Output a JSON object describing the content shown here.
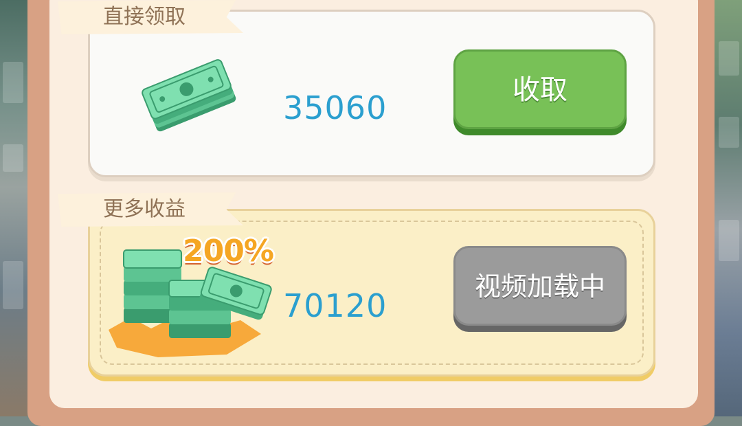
{
  "sections": {
    "direct": {
      "label": "直接领取",
      "amount": "35060",
      "button_label": "收取",
      "icon": "cash-bundle-icon"
    },
    "more": {
      "label": "更多收益",
      "amount": "70120",
      "bonus_badge": "200%",
      "button_label": "视频加载中",
      "icon": "cash-stack-icon"
    }
  },
  "colors": {
    "amount_text": "#2b9fcf",
    "collect_button": "#78c157",
    "video_button": "#9b9b9b",
    "panel_frame": "#d8a184",
    "bonus_badge": "#f5a623"
  }
}
